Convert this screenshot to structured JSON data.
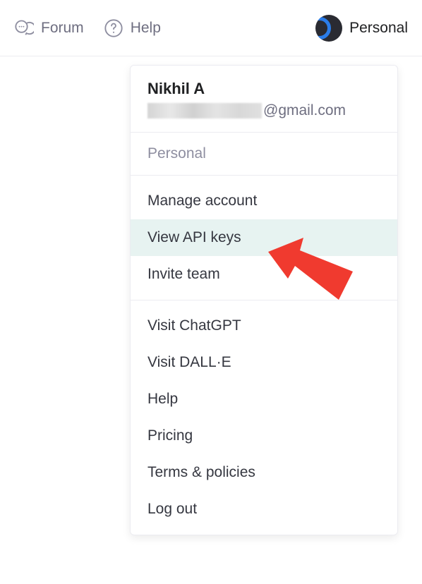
{
  "header": {
    "forum_label": "Forum",
    "help_label": "Help",
    "personal_label": "Personal"
  },
  "dropdown": {
    "user": {
      "name": "Nikhil A",
      "email_suffix": "@gmail.com"
    },
    "section_label": "Personal",
    "group1": [
      {
        "label": "Manage account",
        "highlighted": false
      },
      {
        "label": "View API keys",
        "highlighted": true
      },
      {
        "label": "Invite team",
        "highlighted": false
      }
    ],
    "group2": [
      {
        "label": "Visit ChatGPT"
      },
      {
        "label": "Visit DALL·E"
      },
      {
        "label": "Help"
      },
      {
        "label": "Pricing"
      },
      {
        "label": "Terms & policies"
      },
      {
        "label": "Log out"
      }
    ]
  },
  "annotation": {
    "arrow_color": "#f03a2f"
  }
}
